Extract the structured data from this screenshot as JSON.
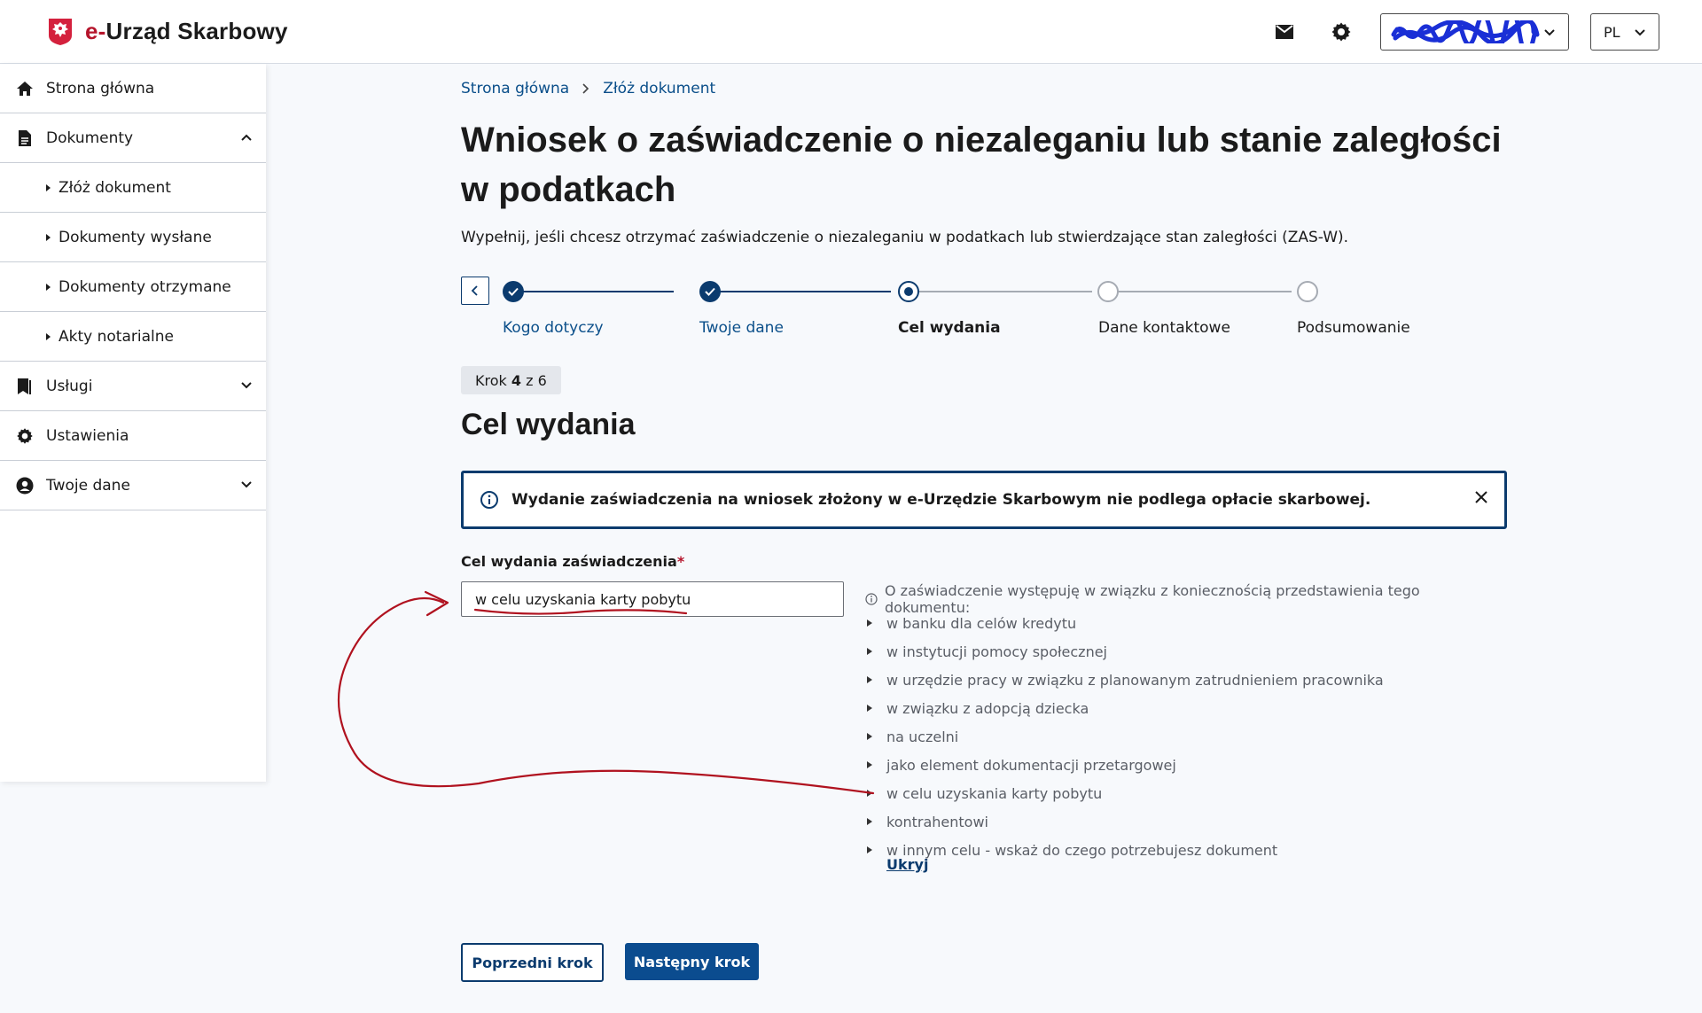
{
  "header": {
    "brand_prefix": "e-",
    "brand_rest": "Urząd Skarbowy",
    "language": "PL"
  },
  "sidebar": {
    "items": [
      {
        "label": "Strona główna",
        "icon": "home-icon"
      },
      {
        "label": "Dokumenty",
        "icon": "document-icon",
        "expanded": true
      },
      {
        "label": "Złóż dokument"
      },
      {
        "label": "Dokumenty wysłane"
      },
      {
        "label": "Dokumenty otrzymane"
      },
      {
        "label": "Akty notarialne"
      },
      {
        "label": "Usługi",
        "icon": "bookmark-icon"
      },
      {
        "label": "Ustawienia",
        "icon": "gear-icon"
      },
      {
        "label": "Twoje dane",
        "icon": "user-circle-icon"
      }
    ]
  },
  "breadcrumb": [
    "Strona główna",
    "Złóż dokument"
  ],
  "page": {
    "title": "Wniosek o zaświadczenie o niezaleganiu lub stanie zaległości w podatkach",
    "description": "Wypełnij, jeśli chcesz otrzymać zaświadczenie o niezaleganiu w podatkach lub stwierdzające stan zaległości (ZAS-W)."
  },
  "stepper": {
    "steps": [
      {
        "label": "Kogo dotyczy",
        "state": "done"
      },
      {
        "label": "Twoje dane",
        "state": "done"
      },
      {
        "label": "Cel wydania",
        "state": "current"
      },
      {
        "label": "Dane kontaktowe",
        "state": "todo"
      },
      {
        "label": "Podsumowanie",
        "state": "todo"
      }
    ],
    "counter_prefix": "Krok",
    "counter_current": "4",
    "counter_sep": "z",
    "counter_total": "6"
  },
  "section": {
    "title": "Cel wydania",
    "alert": "Wydanie zaświadczenia na wniosek złożony w e-Urzędzie Skarbowym nie podlega opłacie skarbowej.",
    "field_label": "Cel wydania zaświadczenia",
    "required_mark": "*",
    "field_value": "w celu uzyskania karty pobytu",
    "hint_intro": "O zaświadczenie występuję w związku z koniecznością przedstawienia tego dokumentu:",
    "hint_items": [
      "w banku dla celów kredytu",
      "w instytucji pomocy społecznej",
      "w urzędzie pracy w związku z planowanym zatrudnieniem pracownika",
      "w związku z adopcją dziecka",
      "na uczelni",
      "jako element dokumentacji przetargowej",
      "w celu uzyskania karty pobytu",
      "kontrahentowi",
      "w innym celu - wskaż do czego potrzebujesz dokument"
    ],
    "hint_toggle": "Ukryj"
  },
  "buttons": {
    "prev": "Poprzedni krok",
    "next": "Następny krok"
  },
  "colors": {
    "primary": "#0b3b6e",
    "brand_red": "#b5142b",
    "annotation": "#b0121f"
  }
}
